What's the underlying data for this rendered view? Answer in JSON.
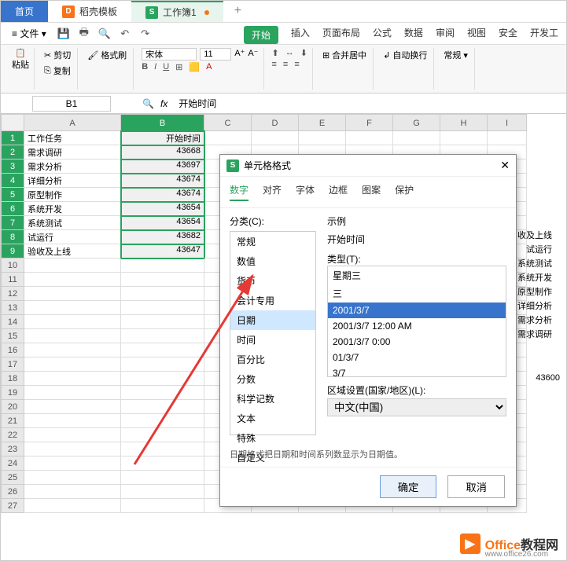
{
  "tabs": {
    "home": "首页",
    "docer": "稻壳模板",
    "workbook": "工作簿1"
  },
  "file_menu": "文件",
  "ribbon_tabs": [
    "开始",
    "插入",
    "页面布局",
    "公式",
    "数据",
    "审阅",
    "视图",
    "安全",
    "开发工"
  ],
  "ribbon": {
    "cut": "剪切",
    "copy": "复制",
    "paste": "粘贴",
    "format_painter": "格式刷",
    "font": "宋体",
    "size": "11",
    "merge": "合并居中",
    "wrap": "自动换行",
    "normal": "常规"
  },
  "namebox": "B1",
  "formula": "开始时间",
  "columns": [
    "A",
    "B",
    "C",
    "D",
    "E",
    "F",
    "G",
    "H",
    "I"
  ],
  "rows": [
    {
      "n": "1",
      "a": "工作任务",
      "b": "开始时间"
    },
    {
      "n": "2",
      "a": "需求调研",
      "b": "43668"
    },
    {
      "n": "3",
      "a": "需求分析",
      "b": "43697"
    },
    {
      "n": "4",
      "a": "详细分析",
      "b": "43674"
    },
    {
      "n": "5",
      "a": "原型制作",
      "b": "43674"
    },
    {
      "n": "6",
      "a": "系统开发",
      "b": "43654"
    },
    {
      "n": "7",
      "a": "系统测试",
      "b": "43654"
    },
    {
      "n": "8",
      "a": "试运行",
      "b": "43682"
    },
    {
      "n": "9",
      "a": "验收及上线",
      "b": "43647"
    },
    {
      "n": "10"
    },
    {
      "n": "11"
    },
    {
      "n": "12"
    },
    {
      "n": "13"
    },
    {
      "n": "14"
    },
    {
      "n": "15"
    },
    {
      "n": "16"
    },
    {
      "n": "17"
    },
    {
      "n": "18"
    },
    {
      "n": "19"
    },
    {
      "n": "20"
    },
    {
      "n": "21"
    },
    {
      "n": "22"
    },
    {
      "n": "23"
    },
    {
      "n": "24"
    },
    {
      "n": "25"
    },
    {
      "n": "26"
    },
    {
      "n": "27"
    }
  ],
  "side": [
    "收及上线",
    "试运行",
    "系统测试",
    "系统开发",
    "原型制作",
    "详细分析",
    "需求分析",
    "需求调研"
  ],
  "side_num": "43600",
  "dialog": {
    "title": "单元格格式",
    "tabs": [
      "数字",
      "对齐",
      "字体",
      "边框",
      "图案",
      "保护"
    ],
    "category_label": "分类(C):",
    "categories": [
      "常规",
      "数值",
      "货币",
      "会计专用",
      "日期",
      "时间",
      "百分比",
      "分数",
      "科学记数",
      "文本",
      "特殊",
      "自定义"
    ],
    "sample_label": "示例",
    "sample_value": "开始时间",
    "type_label": "类型(T):",
    "types": [
      "星期三",
      "三",
      "2001/3/7",
      "2001/3/7 12:00 AM",
      "2001/3/7 0:00",
      "01/3/7",
      "3/7"
    ],
    "locale_label": "区域设置(国家/地区)(L):",
    "locale_value": "中文(中国)",
    "desc": "日期格式把日期和时间系列数显示为日期值。",
    "ok": "确定",
    "cancel": "取消"
  },
  "watermark": {
    "t1": "Office",
    "t2": "教程网",
    "url": "www.office26.com"
  }
}
